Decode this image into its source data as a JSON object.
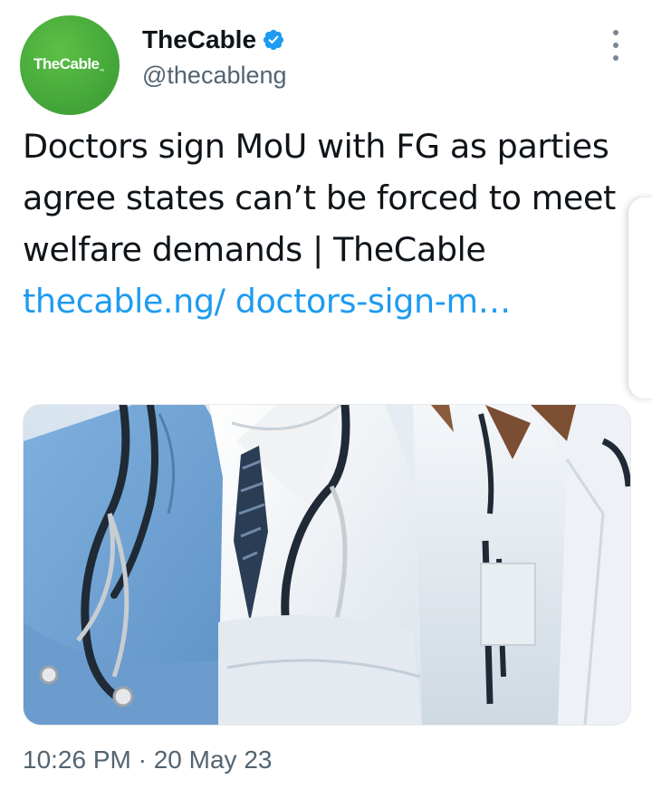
{
  "account": {
    "avatar_text": "TheCable",
    "avatar_mark": "™",
    "display_name": "TheCable",
    "handle": "@thecableng",
    "verified_icon": "verified-badge-icon",
    "brand_color": "#45a83a",
    "verified_color": "#1d9bf0"
  },
  "menu": {
    "icon": "more-vertical-icon"
  },
  "tweet": {
    "text": "Doctors sign MoU with FG as parties agree states can’t be forced to meet welfare demands | TheCable ",
    "link_text": "thecable.ng/ doctors-sign-m…",
    "link_color": "#1d9bf0"
  },
  "media": {
    "icon": "doctors-photo-image"
  },
  "meta": {
    "timestamp": "10:26 PM · 20 May 23"
  }
}
